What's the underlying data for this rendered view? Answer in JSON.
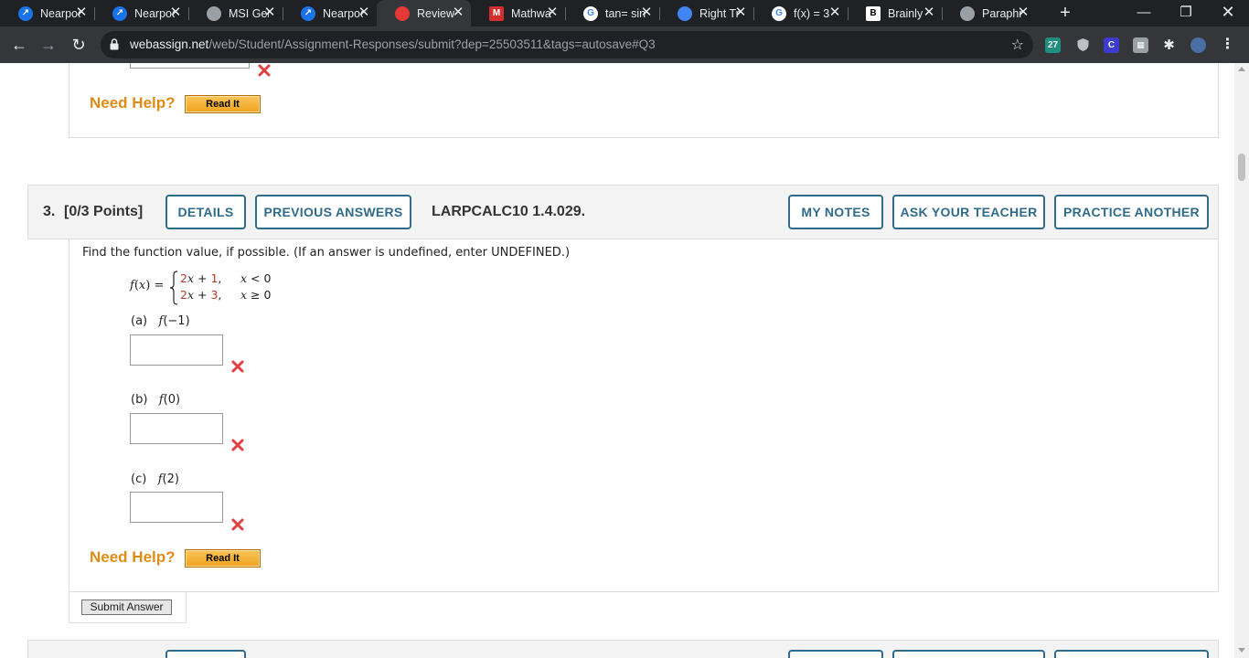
{
  "browser": {
    "tabs": [
      {
        "title": "Nearpod",
        "icon": "nearpod-icon",
        "color": "#1a73e8"
      },
      {
        "title": "Nearpod",
        "icon": "nearpod-icon",
        "color": "#1a73e8"
      },
      {
        "title": "MSI Gen",
        "icon": "msi-icon",
        "color": "#9aa0a6"
      },
      {
        "title": "Nearpod",
        "icon": "nearpod-icon",
        "color": "#1a73e8"
      },
      {
        "title": "Review",
        "icon": "webassign-icon",
        "color": "#e53935",
        "active": true
      },
      {
        "title": "Mathway",
        "icon": "mathway-icon",
        "color": "#d32f2f"
      },
      {
        "title": "tan= sin",
        "icon": "google-icon",
        "color": "#ffffff"
      },
      {
        "title": "Right Tri",
        "icon": "math-icon",
        "color": "#4285f4"
      },
      {
        "title": "f(x) = 3",
        "icon": "google-icon",
        "color": "#ffffff"
      },
      {
        "title": "Brainly",
        "icon": "brainly-icon",
        "color": "#000000"
      },
      {
        "title": "Paraphr",
        "icon": "quill-icon",
        "color": "#9aa0a6"
      }
    ],
    "url_host": "webassign.net",
    "url_path": "/web/Student/Assignment-Responses/submit?dep=25503511&tags=autosave#Q3",
    "extension_badge": "27"
  },
  "prev_question": {
    "need_help": "Need Help?",
    "read_it": "Read It"
  },
  "question": {
    "number": "3.",
    "points": "[0/3 Points]",
    "details_label": "DETAILS",
    "previous_answers_label": "PREVIOUS ANSWERS",
    "code": "LARPCALC10 1.4.029.",
    "my_notes_label": "MY NOTES",
    "ask_teacher_label": "ASK YOUR TEACHER",
    "practice_another_label": "PRACTICE ANOTHER",
    "prompt": "Find the function value, if possible. (If an answer is undefined, enter UNDEFINED.)",
    "function_lhs": "f(x) =",
    "case1": {
      "coef": "2",
      "var": "x",
      "op": " + ",
      "const": "1",
      "comma": ",",
      "cond": "x < 0"
    },
    "case2": {
      "coef": "2",
      "var": "x",
      "op": " + ",
      "const": "3",
      "comma": ",",
      "cond": "x ≥ 0"
    },
    "parts": [
      {
        "label": "(a)",
        "expr": "f(−1)",
        "value": ""
      },
      {
        "label": "(b)",
        "expr": "f(0)",
        "value": ""
      },
      {
        "label": "(c)",
        "expr": "f(2)",
        "value": ""
      }
    ],
    "need_help": "Need Help?",
    "read_it": "Read It",
    "submit_label": "Submit Answer"
  },
  "colors": {
    "accent": "#2f6b8a",
    "need_help": "#e08c14",
    "incorrect": "#e04040"
  }
}
